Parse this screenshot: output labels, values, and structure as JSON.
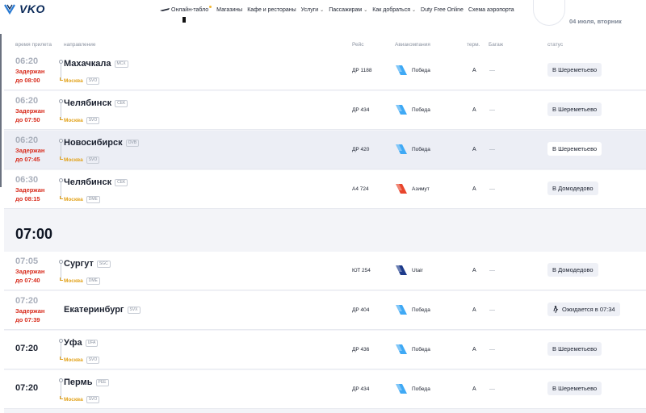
{
  "header": {
    "logo_text": "VKO",
    "nav": [
      "Онлайн-табло",
      "Магазины",
      "Кафе и рестораны",
      "Услуги",
      "Пассажирам",
      "Как добраться",
      "Duty Free Online",
      "Схема аэропорта"
    ],
    "date": "04 июля, вторник"
  },
  "columns": {
    "time": "время прилета",
    "direction": "направление",
    "flight": "Рейс",
    "airline": "Авиакомпания",
    "terminal": "терм.",
    "baggage": "Багаж",
    "status": "статус"
  },
  "hour_divider": "07:00",
  "flights": [
    {
      "time": "06:20",
      "delay1": "Задержан",
      "delay2": "до 08:00",
      "city": "Махачкала",
      "code": "MCX",
      "via": "Москва",
      "via_code": "SVO",
      "flight": "ДР 1188",
      "airline": "Победа",
      "airline_color": "#3fa9f5",
      "terminal": "A",
      "baggage": "—",
      "status": "В Шереметьево"
    },
    {
      "time": "06:20",
      "delay1": "Задержан",
      "delay2": "до 07:50",
      "city": "Челябинск",
      "code": "CEK",
      "via": "Москва",
      "via_code": "SVO",
      "flight": "ДР 434",
      "airline": "Победа",
      "airline_color": "#3fa9f5",
      "terminal": "A",
      "baggage": "—",
      "status": "В Шереметьево"
    },
    {
      "time": "06:20",
      "delay1": "Задержан",
      "delay2": "до 07:45",
      "city": "Новосибирск",
      "code": "OVB",
      "via": "Москва",
      "via_code": "SVO",
      "flight": "ДР 420",
      "airline": "Победа",
      "airline_color": "#3fa9f5",
      "terminal": "A",
      "baggage": "—",
      "status": "В Шереметьево"
    },
    {
      "time": "06:30",
      "delay1": "Задержан",
      "delay2": "до 08:15",
      "city": "Челябинск",
      "code": "CEK",
      "via": "Москва",
      "via_code": "DME",
      "flight": "А4 724",
      "airline": "Азимут",
      "airline_color": "#e8452c",
      "terminal": "A",
      "baggage": "—",
      "status": "В Домодедово"
    },
    {
      "time": "07:05",
      "delay1": "Задержан",
      "delay2": "до 07:40",
      "city": "Сургут",
      "code": "SGC",
      "via": "Москва",
      "via_code": "DME",
      "flight": "ЮТ 254",
      "airline": "Utair",
      "airline_color": "#1d3b8b",
      "terminal": "A",
      "baggage": "—",
      "status": "В Домодедово"
    },
    {
      "time": "07:20",
      "delay1": "Задержан",
      "delay2": "до 07:39",
      "city": "Екатеринбург",
      "code": "SVX",
      "via": "",
      "via_code": "",
      "flight": "ДР 404",
      "airline": "Победа",
      "airline_color": "#3fa9f5",
      "terminal": "A",
      "baggage": "—",
      "status": "Ожидается в 07:34"
    },
    {
      "time": "07:20",
      "delay1": "",
      "delay2": "",
      "city": "Уфа",
      "code": "UFA",
      "via": "Москва",
      "via_code": "SVO",
      "flight": "ДР 436",
      "airline": "Победа",
      "airline_color": "#3fa9f5",
      "terminal": "A",
      "baggage": "—",
      "status": "В Шереметьево"
    },
    {
      "time": "07:20",
      "delay1": "",
      "delay2": "",
      "city": "Пермь",
      "code": "PEE",
      "via": "Москва",
      "via_code": "SVO",
      "flight": "ДР 434",
      "airline": "Победа",
      "airline_color": "#3fa9f5",
      "terminal": "A",
      "baggage": "—",
      "status": "В Шереметьево"
    }
  ]
}
